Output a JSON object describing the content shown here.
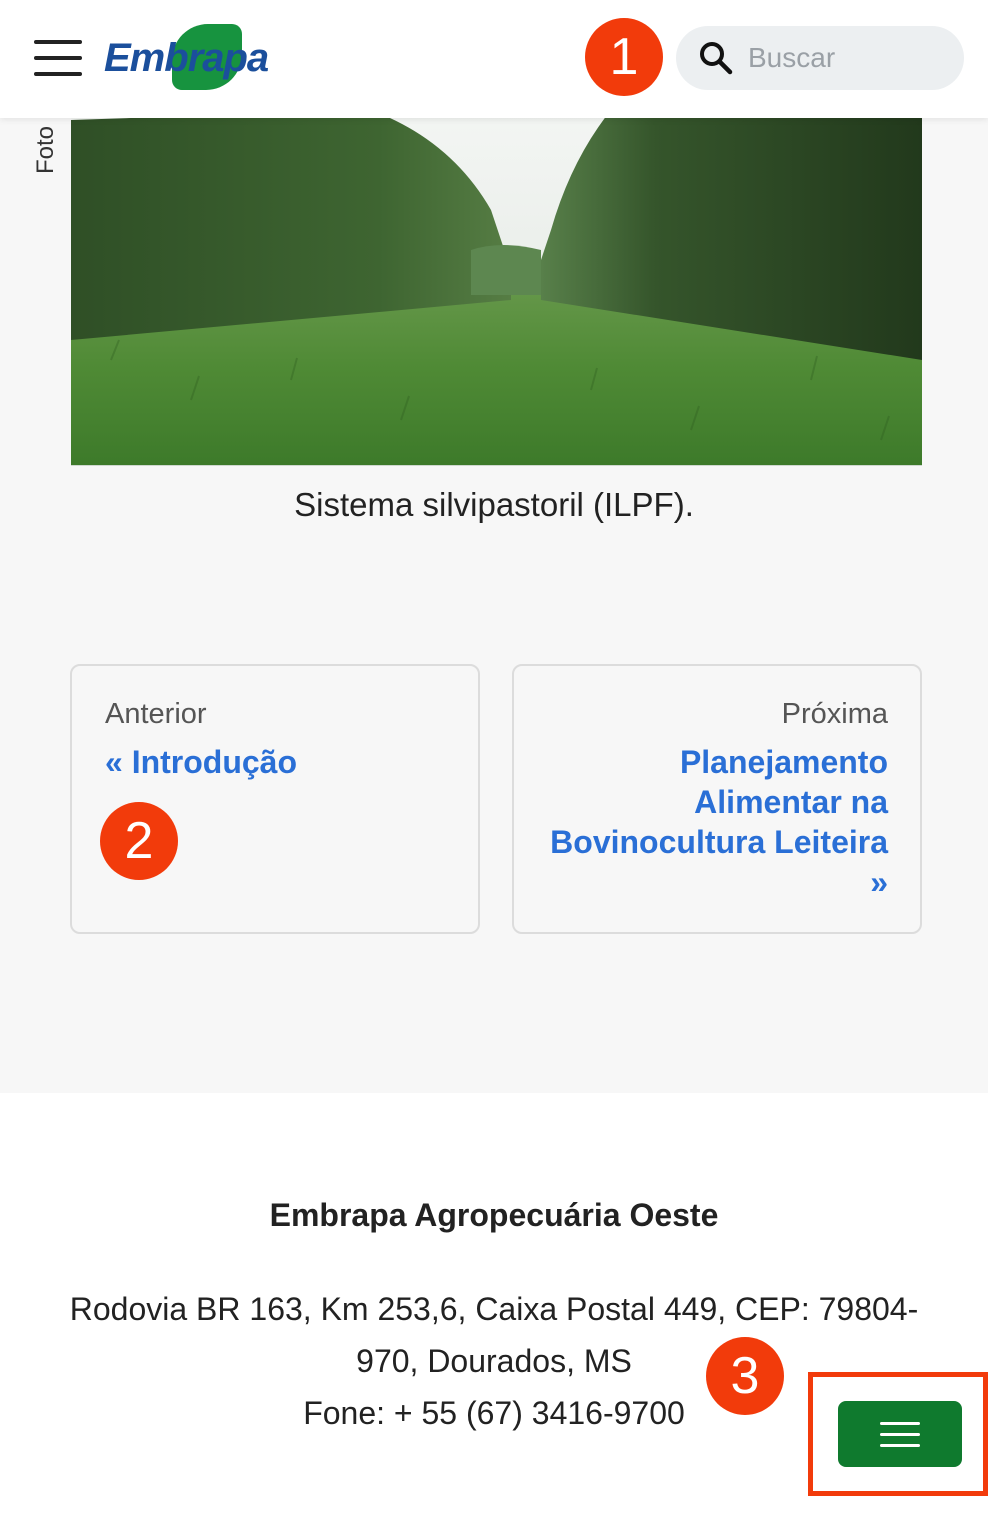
{
  "header": {
    "logo_text_1": "Emb",
    "logo_text_2": "rapa",
    "search_placeholder": "Buscar"
  },
  "annotations": {
    "badge_1": "1",
    "badge_2": "2",
    "badge_3": "3"
  },
  "content": {
    "photo_credit": "Foto",
    "caption": "Sistema silvipastoril (ILPF)."
  },
  "pagination": {
    "prev_label": "Anterior",
    "prev_title": "« Introdução",
    "next_label": "Próxima",
    "next_title": "Planejamento Alimentar na Bovinocultura Leiteira »"
  },
  "footer": {
    "org_name": "Embrapa Agropecuária Oeste",
    "address": "Rodovia BR 163, Km 253,6, Caixa Postal 449, CEP: 79804-970, Dourados, MS",
    "phone": "Fone: + 55 (67) 3416-9700"
  },
  "colors": {
    "brand_blue": "#1b4f9c",
    "brand_green": "#17933f",
    "link_blue": "#2a6fd6",
    "annotation_red": "#f23b0b",
    "menu_green": "#0f7a2e"
  },
  "icons": {
    "menu": "hamburger-menu-icon",
    "search": "magnifier-icon",
    "floating_menu": "hamburger-menu-icon"
  }
}
